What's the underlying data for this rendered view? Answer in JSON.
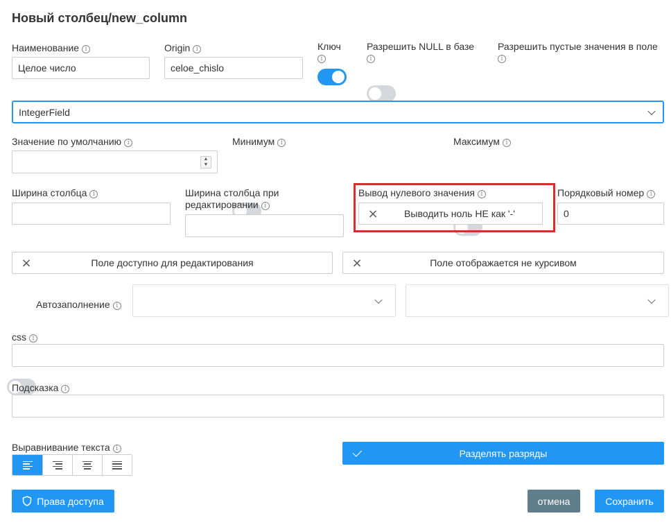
{
  "dialog": {
    "title": "Новый столбец/new_column"
  },
  "fields": {
    "name": {
      "label": "Наименование",
      "value": "Целое число"
    },
    "origin": {
      "label": "Origin",
      "value": "celoe_chislo"
    },
    "key": {
      "label": "Ключ",
      "on": true
    },
    "allow_null": {
      "label": "Разрешить NULL в базе",
      "on": false
    },
    "allow_empty": {
      "label": "Разрешить пустые значения в поле",
      "on": false
    },
    "field_type": {
      "value": "IntegerField"
    },
    "default_value": {
      "label": "Значение по умолчанию",
      "value": ""
    },
    "minimum": {
      "label": "Минимум",
      "on": false
    },
    "maximum": {
      "label": "Максимум",
      "on": false
    },
    "column_width": {
      "label": "Ширина столбца",
      "value": ""
    },
    "column_width_edit": {
      "label_line1": "Ширина столбца при",
      "label_line2": "редактировании",
      "value": ""
    },
    "zero_output": {
      "label": "Вывод нулевого значения",
      "button": "Выводить ноль НЕ как '-'"
    },
    "order_number": {
      "label": "Порядковый номер",
      "value": "0"
    },
    "editable": {
      "button": "Поле доступно для редактирования"
    },
    "italic": {
      "button": "Поле отображается не курсивом"
    },
    "autofill": {
      "label": "Автозаполнение",
      "on": false
    },
    "css": {
      "label": "css",
      "value": ""
    },
    "hint": {
      "label": "Подсказка",
      "value": ""
    },
    "text_align": {
      "label": "Выравнивание текста",
      "selected": "left"
    },
    "digit_separator": {
      "button": "Разделять разряды"
    }
  },
  "footer": {
    "access_rights": "Права доступа",
    "cancel": "отмена",
    "save": "Сохранить"
  },
  "icons": {
    "info": "info-icon",
    "close": "close-icon",
    "check": "check-icon",
    "shield": "shield-icon",
    "chevron": "chevron-down-icon"
  },
  "colors": {
    "accent": "#2196f3",
    "cancel": "#607d8b",
    "highlight": "#d32f2f",
    "toggle_off": "#d4d7dc"
  }
}
